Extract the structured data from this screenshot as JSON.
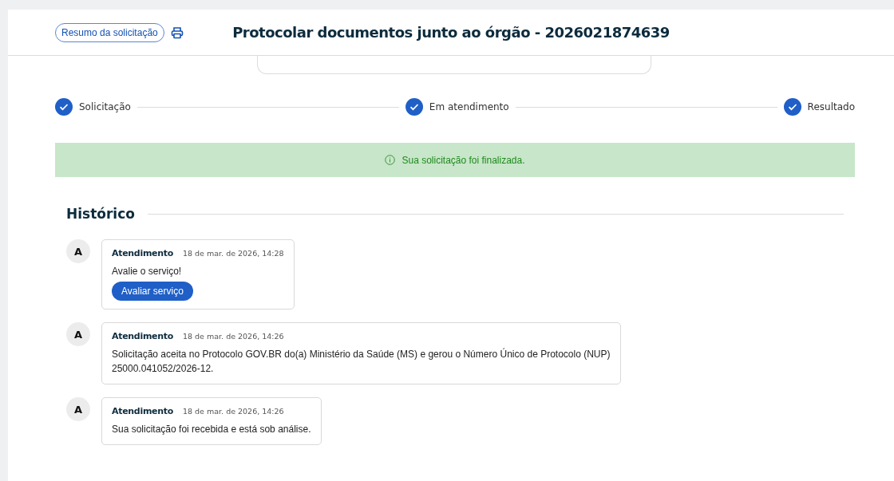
{
  "header": {
    "summary_button": "Resumo da solicitação",
    "title": "Protocolar documentos junto ao órgão - 2026021874639"
  },
  "steps": [
    {
      "label": "Solicitação",
      "completed": true
    },
    {
      "label": "Em atendimento",
      "completed": true
    },
    {
      "label": "Resultado",
      "completed": true
    }
  ],
  "alert": {
    "text": "Sua solicitação foi finalizada."
  },
  "history": {
    "title": "Histórico",
    "items": [
      {
        "avatar": "A",
        "author": "Atendimento",
        "time": "18 de mar. de 2026, 14:28",
        "text": "Avalie o serviço!",
        "button": "Avaliar serviço"
      },
      {
        "avatar": "A",
        "author": "Atendimento",
        "time": "18 de mar. de 2026, 14:26",
        "text": "Solicitação aceita no Protocolo GOV.BR do(a) Ministério da Saúde (MS) e gerou o Número Único de Protocolo (NUP)\n25000.041052/2026-12."
      },
      {
        "avatar": "A",
        "author": "Atendimento",
        "time": "18 de mar. de 2026, 14:26",
        "text": "Sua solicitação foi recebida e está sob análise."
      }
    ]
  }
}
